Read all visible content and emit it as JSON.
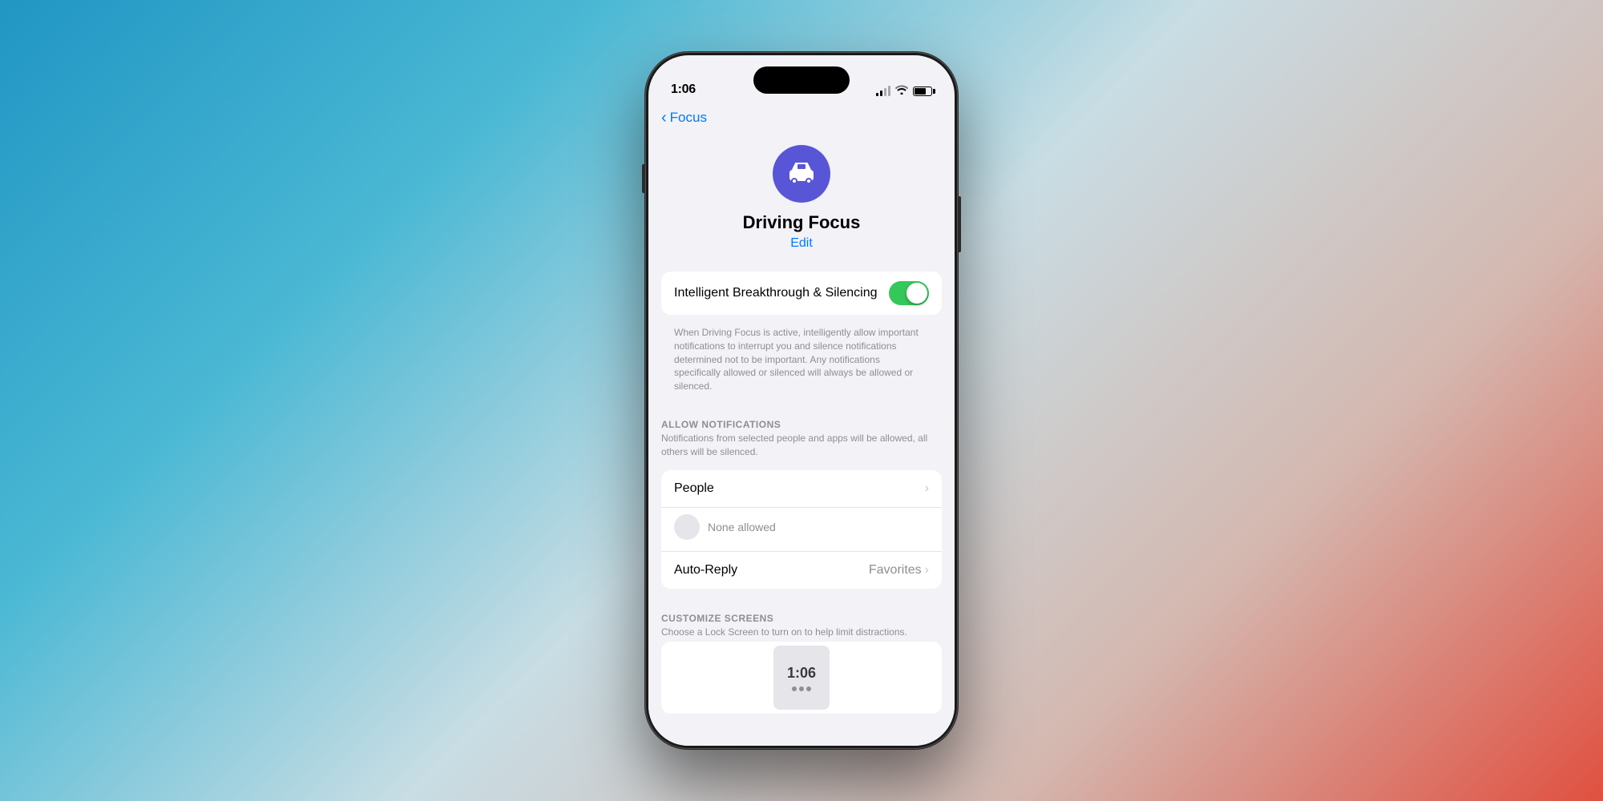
{
  "background": {
    "gradient": "blue-to-red"
  },
  "status_bar": {
    "time": "1:06",
    "signal_strength": 2,
    "wifi": true,
    "battery_percent": 70
  },
  "nav": {
    "back_label": "Focus",
    "back_icon": "chevron-left"
  },
  "header": {
    "icon_alt": "car icon",
    "title": "Driving Focus",
    "edit_label": "Edit"
  },
  "intelligent_section": {
    "toggle_label": "Intelligent Breakthrough & Silencing",
    "toggle_on": true,
    "description": "When Driving Focus is active, intelligently allow important notifications to interrupt you and silence notifications determined not to be important. Any notifications specifically allowed or silenced will always be allowed or silenced."
  },
  "allow_notifications": {
    "section_title": "ALLOW NOTIFICATIONS",
    "section_subtitle": "Notifications from selected people and apps will be allowed, all others will be silenced.",
    "people_label": "People",
    "none_allowed_label": "None allowed",
    "auto_reply_label": "Auto-Reply",
    "auto_reply_value": "Favorites"
  },
  "customize_screens": {
    "section_title": "CUSTOMIZE SCREENS",
    "section_subtitle": "Choose a Lock Screen to turn on to help limit distractions."
  },
  "preview": {
    "time": "1:06"
  }
}
